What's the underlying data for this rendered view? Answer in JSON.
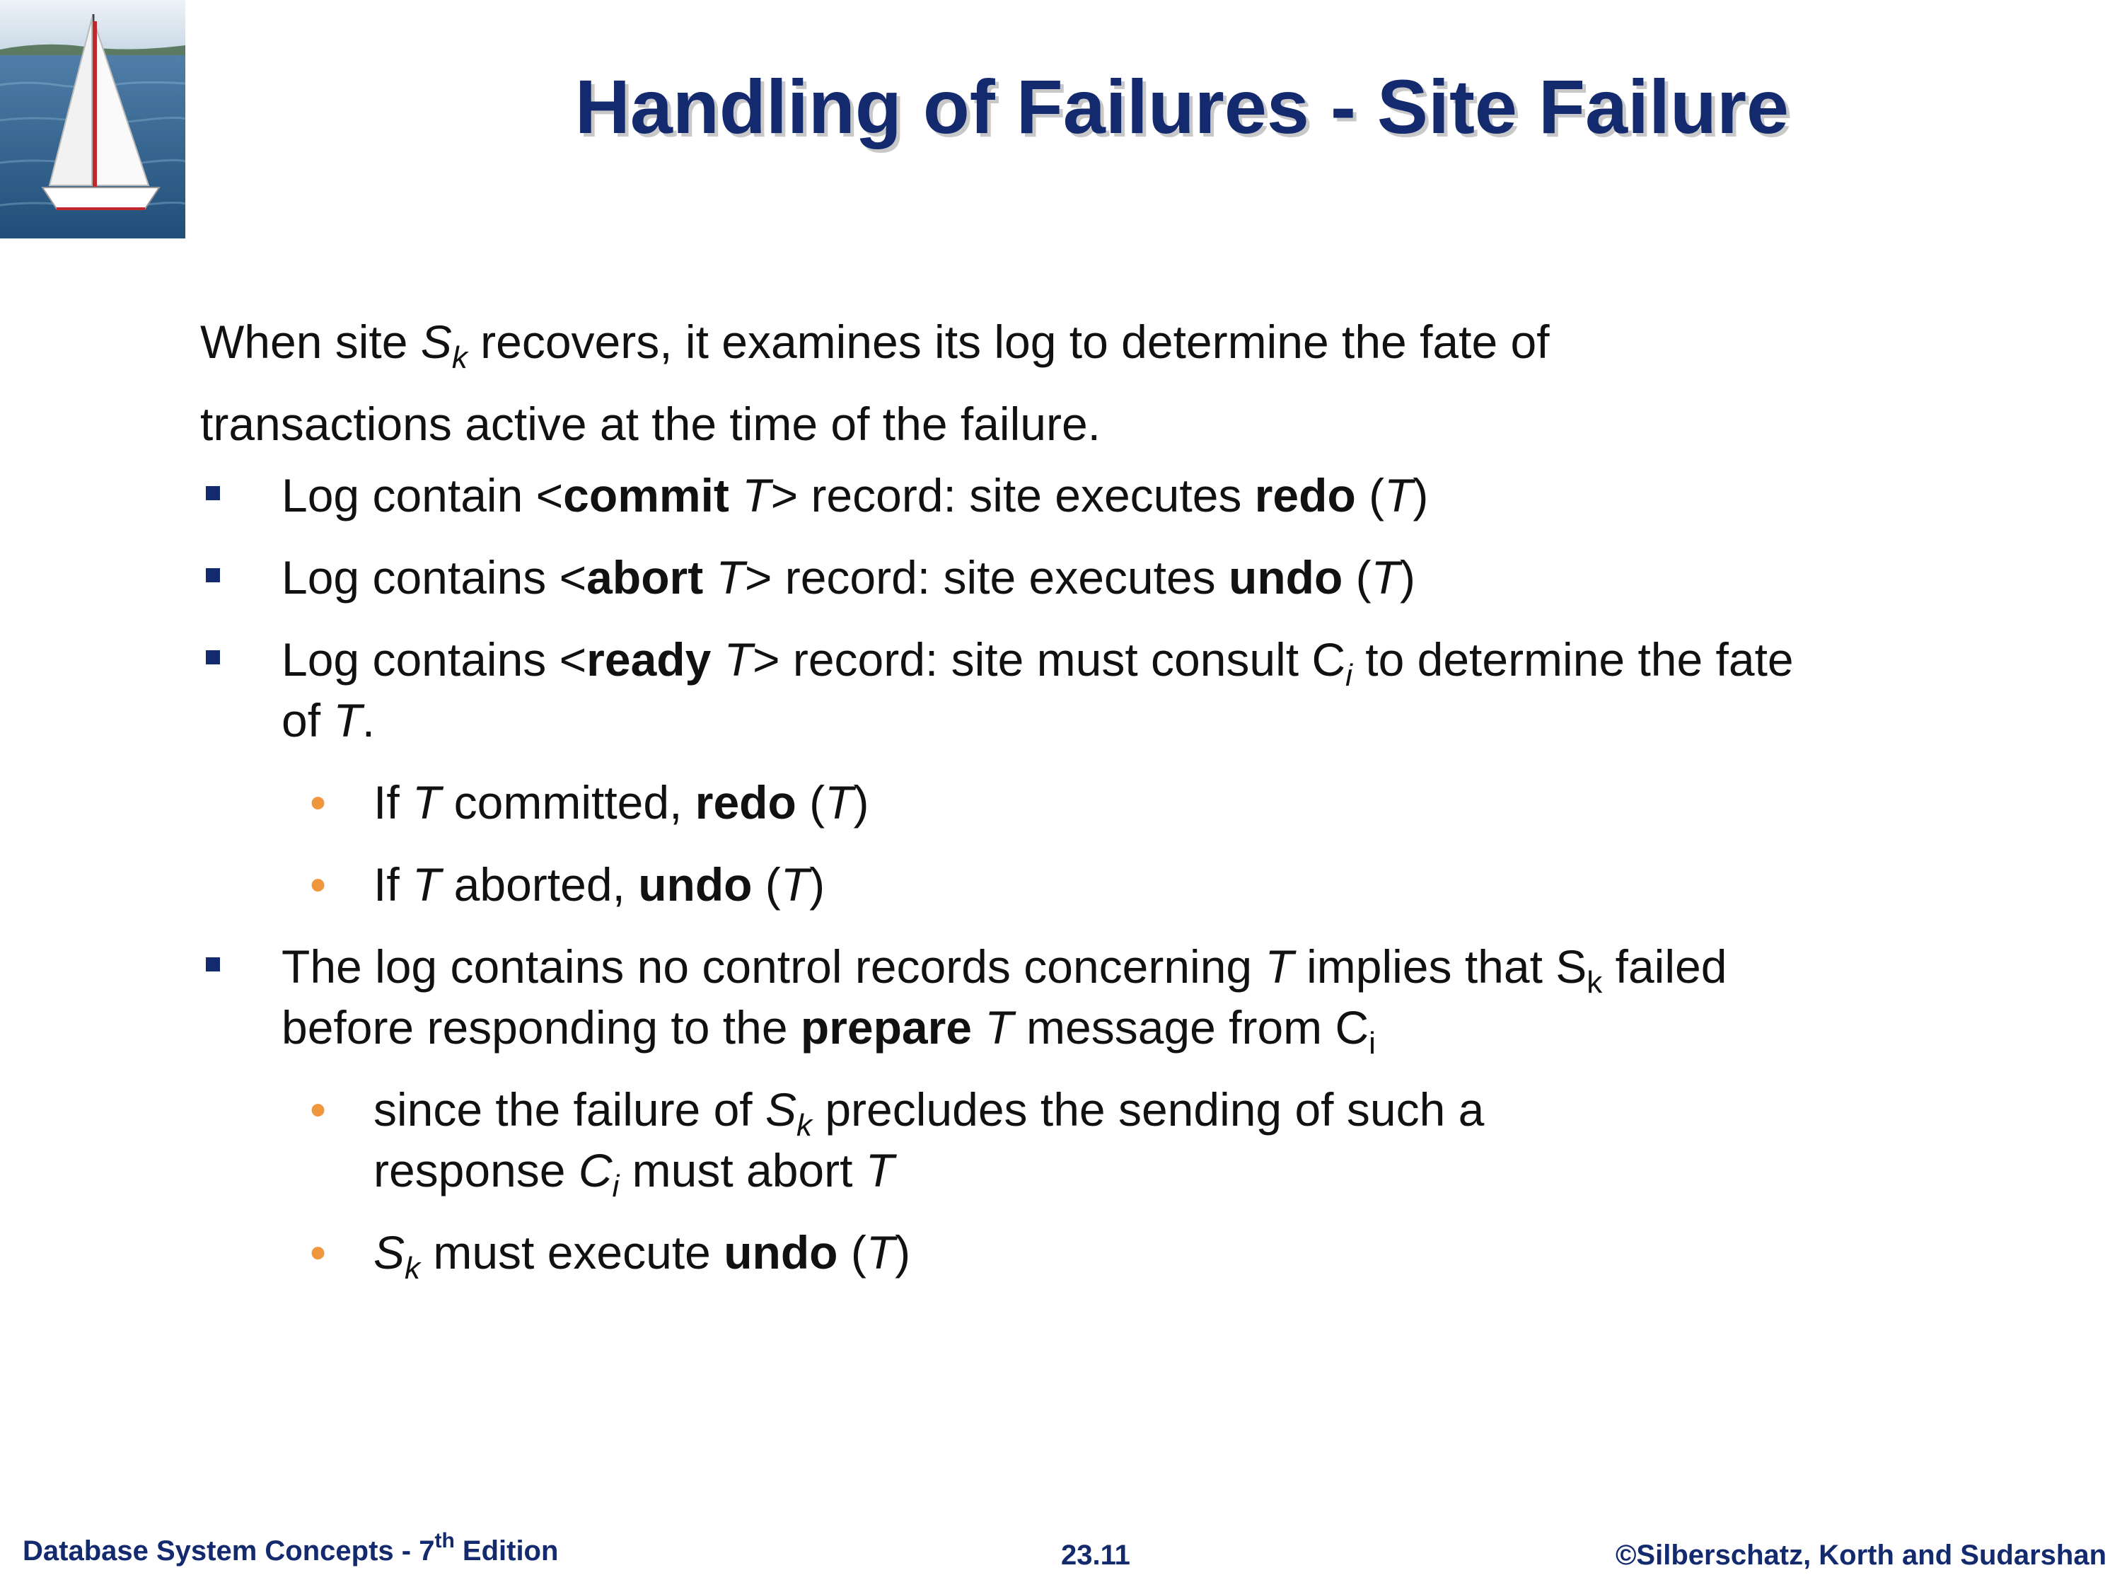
{
  "title": "Handling of Failures - Site Failure",
  "intro": {
    "p1_a": "When site ",
    "p1_S": "S",
    "p1_k": "k",
    "p1_b": " recovers, it examines its log to determine the fate of",
    "p2": "transactions active at the time of the failure."
  },
  "bullet1": {
    "a": "Log contain <",
    "commit": "commit",
    "T": "T",
    "b": "> record: site executes ",
    "redo": "redo",
    "c": " (",
    "T2": "T",
    "d": ")"
  },
  "bullet2": {
    "a": "Log contains <",
    "abort": "abort",
    "T": "T",
    "b": "> record: site executes ",
    "undo": "undo",
    "c": " (",
    "T2": "T",
    "d": ")"
  },
  "bullet3": {
    "a": "Log contains <",
    "ready": "ready",
    "T": "T",
    "b": "> record: site must consult C",
    "i": "i",
    "c": " to determine the fate",
    "d": "of ",
    "T2": "T",
    "e": ".",
    "sub1": {
      "a": "If ",
      "T": "T",
      "b": " committed, ",
      "redo": "redo",
      "c": " (",
      "T2": "T",
      "d": ")"
    },
    "sub2": {
      "a": "If ",
      "T": "T",
      "b": " aborted, ",
      "undo": "undo",
      "c": " (",
      "T2": "T",
      "d": ")"
    }
  },
  "bullet4": {
    "a": "The log contains no control records concerning ",
    "T": "T",
    "b": " implies that S",
    "k": "k",
    "c": " failed",
    "d": "before responding to the  ",
    "prepare": "prepare",
    "e": " ",
    "T2": "T",
    "f": " message from C",
    "i": "i",
    "sub1": {
      "a": "since the failure of ",
      "S": "S",
      "k": "k",
      "b": " precludes the sending of such a",
      "c": "response ",
      "C": "C",
      "i": "i",
      "d": " must abort ",
      "T": "T"
    },
    "sub2": {
      "S": "S",
      "k": "k",
      "a": " must execute ",
      "undo": "undo",
      "b": " (",
      "T": "T",
      "c": ")"
    }
  },
  "footer": {
    "left_a": "Database System Concepts - 7",
    "left_sup": "th",
    "left_b": " Edition",
    "center": "23.11",
    "right": "©Silberschatz, Korth and Sudarshan"
  }
}
